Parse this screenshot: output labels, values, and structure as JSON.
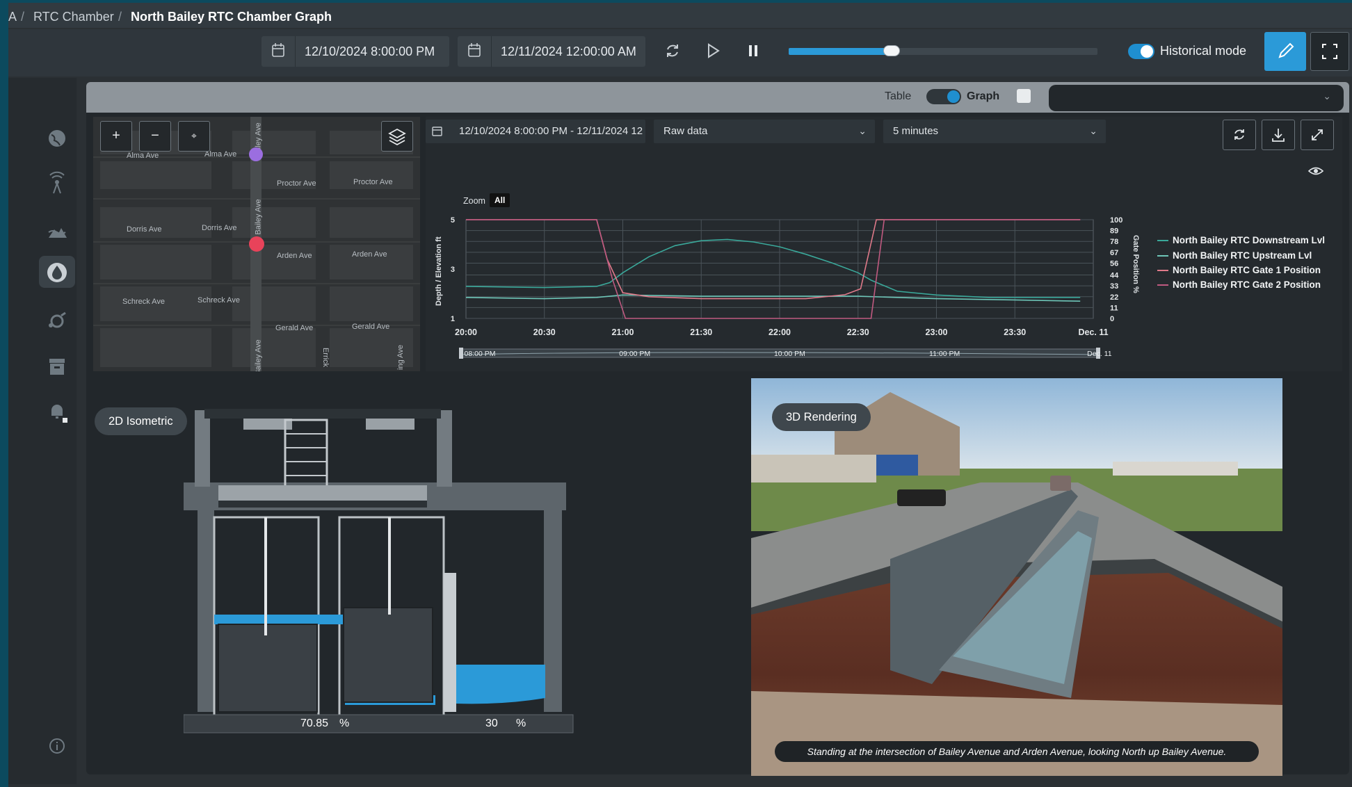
{
  "breadcrumb": {
    "items": [
      "A",
      "RTC Chamber",
      "North Bailey RTC Chamber Graph"
    ],
    "separator": "/"
  },
  "toolbar": {
    "start_datetime": "12/10/2024 8:00:00 PM",
    "end_datetime": "12/11/2024 12:00:00 AM",
    "playback_progress_pct": 33,
    "historical_mode_label": "Historical mode",
    "historical_mode_on": true,
    "icons": [
      "calendar-icon",
      "refresh-icon",
      "play-icon",
      "pause-icon",
      "pencil-icon",
      "fullscreen-icon"
    ]
  },
  "sidebar": {
    "items": [
      "globe-icon",
      "antenna-icon",
      "landscape-icon",
      "drop-icon",
      "gauge-icon",
      "archive-icon",
      "bell-icon",
      "info-icon"
    ],
    "active_index": 3
  },
  "panel": {
    "table_label": "Table",
    "graph_label": "Graph",
    "graph_on": true,
    "dropdown_value": ""
  },
  "map": {
    "streets": [
      {
        "name": "Alma Ave"
      },
      {
        "name": "Alma Ave"
      },
      {
        "name": "Proctor Ave"
      },
      {
        "name": "Proctor Ave"
      },
      {
        "name": "Dorris Ave"
      },
      {
        "name": "Dorris Ave"
      },
      {
        "name": "Arden Ave"
      },
      {
        "name": "Arden Ave"
      },
      {
        "name": "Schreck Ave"
      },
      {
        "name": "Schreck Ave"
      },
      {
        "name": "Gerald Ave"
      },
      {
        "name": "Gerald Ave"
      },
      {
        "name": "Bailey Ave"
      },
      {
        "name": "Bailey Ave"
      },
      {
        "name": "Bailey Ave"
      },
      {
        "name": "Errick"
      },
      {
        "name": "ing Ave"
      }
    ],
    "buttons": {
      "zoom_in": "+",
      "zoom_out": "−",
      "center": "⌖"
    },
    "markers": [
      {
        "color": "#9b6ee0"
      },
      {
        "color": "#e8435a"
      }
    ]
  },
  "chart_controls": {
    "date_range": "12/10/2024 8:00:00 PM - 12/11/2024 12",
    "data_type": "Raw data",
    "interval": "5 minutes",
    "zoom_label": "Zoom",
    "zoom_all": "All"
  },
  "chart_data": {
    "type": "line",
    "ylabel_left": "Depth / Elevation ft",
    "ylabel_right": "Gate Position %",
    "left_ticks": [
      "5",
      "3",
      "1"
    ],
    "ylim_left": [
      1,
      5
    ],
    "right_ticks": [
      "100",
      "89",
      "78",
      "67",
      "56",
      "44",
      "33",
      "22",
      "11",
      "0"
    ],
    "ylim_right": [
      0,
      100
    ],
    "x_ticks": [
      "20:00",
      "20:30",
      "21:00",
      "21:30",
      "22:00",
      "22:30",
      "23:00",
      "23:30",
      "Dec. 11"
    ],
    "navigator_labels": [
      "08:00 PM",
      "09:00 PM",
      "10:00 PM",
      "11:00 PM",
      "Dec. 11"
    ],
    "grid": true,
    "legend_position": "right",
    "series": [
      {
        "name": "North Bailey RTC Downstream Lvl",
        "color": "#3aa89a",
        "axis": "left",
        "x": [
          0,
          30,
          50,
          55,
          60,
          70,
          80,
          90,
          100,
          110,
          120,
          130,
          140,
          150,
          155,
          165,
          180,
          200,
          235
        ],
        "y": [
          2.3,
          2.25,
          2.3,
          2.45,
          2.85,
          3.5,
          3.95,
          4.15,
          4.2,
          4.1,
          3.9,
          3.6,
          3.25,
          2.85,
          2.55,
          2.1,
          1.95,
          1.85,
          1.85
        ]
      },
      {
        "name": "North Bailey RTC Upstream Lvl",
        "color": "#6ec6b8",
        "axis": "left",
        "x": [
          0,
          30,
          50,
          60,
          90,
          120,
          150,
          180,
          210,
          235
        ],
        "y": [
          1.85,
          1.8,
          1.85,
          1.95,
          1.9,
          1.9,
          1.9,
          1.8,
          1.75,
          1.7
        ]
      },
      {
        "name": "North Bailey RTC Gate 1 Position",
        "color": "#e07a8a",
        "axis": "right",
        "x": [
          0,
          50,
          54,
          60,
          70,
          90,
          110,
          130,
          145,
          151,
          157,
          165,
          200,
          235
        ],
        "y": [
          100,
          100,
          60,
          26,
          22,
          20,
          20,
          20,
          24,
          30,
          100,
          100,
          100,
          100
        ]
      },
      {
        "name": "North Bailey RTC Gate 2 Position",
        "color": "#c05a80",
        "axis": "right",
        "x": [
          0,
          50,
          56,
          61,
          100,
          140,
          149,
          155,
          160,
          170,
          200,
          235
        ],
        "y": [
          100,
          100,
          40,
          0,
          0,
          0,
          0,
          0,
          100,
          100,
          100,
          100
        ]
      }
    ]
  },
  "isometric": {
    "label": "2D Isometric",
    "gate1_value": "70.85",
    "gate2_value": "30",
    "unit": "%"
  },
  "rendering": {
    "label": "3D Rendering",
    "caption": "Standing at the intersection of Bailey Avenue and Arden Avenue, looking North up Bailey Avenue."
  }
}
